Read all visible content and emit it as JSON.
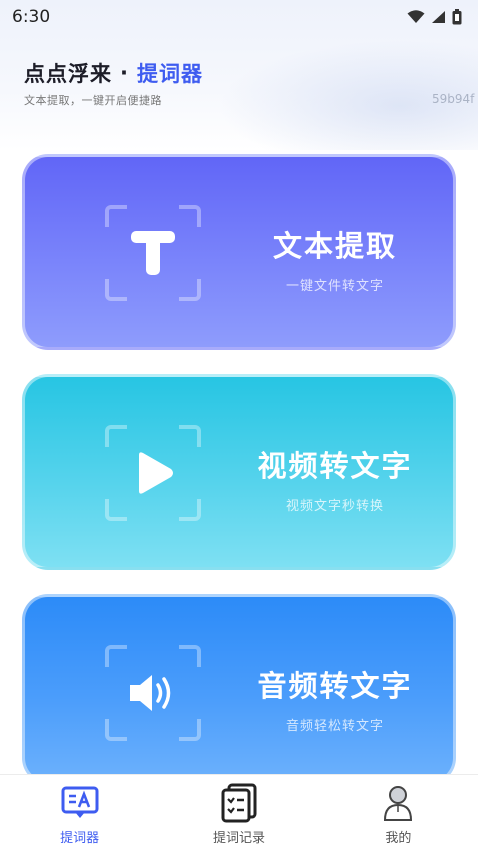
{
  "status_bar": {
    "time": "6:30"
  },
  "header": {
    "title_main": "点点浮来",
    "title_separator": "·",
    "title_accent": "提词器",
    "subtitle": "文本提取，一键开启便捷路",
    "corner_code": "59b94f"
  },
  "cards": [
    {
      "title": "文本提取",
      "desc": "一键文件转文字",
      "icon": "text-t-icon"
    },
    {
      "title": "视频转文字",
      "desc": "视频文字秒转换",
      "icon": "play-icon"
    },
    {
      "title": "音频转文字",
      "desc": "音频轻松转文字",
      "icon": "speaker-icon"
    }
  ],
  "bottom_nav": [
    {
      "label": "提词器",
      "icon": "teleprompter-icon",
      "active": true
    },
    {
      "label": "提词记录",
      "icon": "record-list-icon",
      "active": false
    },
    {
      "label": "我的",
      "icon": "profile-icon",
      "active": false
    }
  ],
  "colors": {
    "accent": "#3e5cf0",
    "card_text_extract": "#6166f7",
    "card_video": "#27c5e3",
    "card_audio": "#2c8bf8"
  }
}
